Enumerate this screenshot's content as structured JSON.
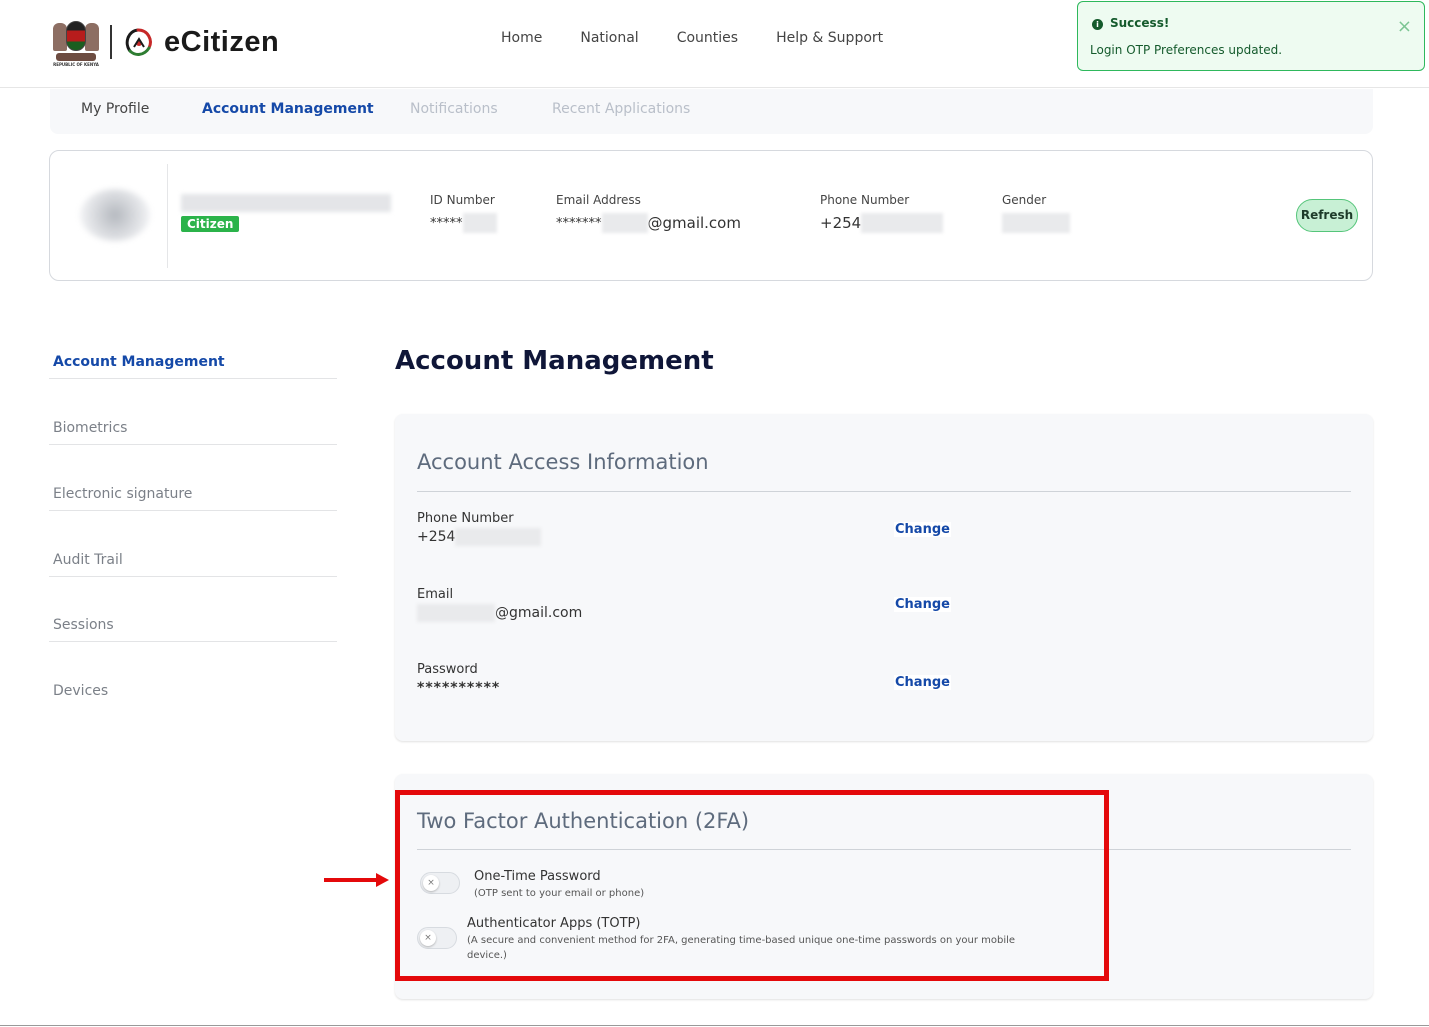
{
  "header": {
    "coat_caption": "REPUBLIC OF KENYA",
    "brand": "eCitizen",
    "nav": [
      "Home",
      "National",
      "Counties",
      "Help & Support"
    ]
  },
  "toast": {
    "title": "Success!",
    "message": "Login OTP Preferences updated.",
    "close": "×"
  },
  "tabs": [
    "My Profile",
    "Account Management",
    "Notifications",
    "Recent Applications"
  ],
  "profile": {
    "badge": "Citizen",
    "id_label": "ID Number",
    "id_value": "*****",
    "email_label": "Email Address",
    "email_prefix": "*******",
    "email_suffix": "@gmail.com",
    "phone_label": "Phone Number",
    "phone_prefix": "+254",
    "gender_label": "Gender",
    "refresh_label": "Refresh"
  },
  "sidebar": {
    "items": [
      "Account Management",
      "Biometrics",
      "Electronic signature",
      "Audit Trail",
      "Sessions",
      "Devices"
    ]
  },
  "main": {
    "title": "Account Management",
    "access": {
      "title": "Account Access Information",
      "phone_label": "Phone Number",
      "phone_prefix": "+254",
      "email_label": "Email",
      "email_suffix": "@gmail.com",
      "password_label": "Password",
      "password_value": "**********",
      "change_label": "Change"
    },
    "tfa": {
      "title": "Two Factor Authentication (2FA)",
      "otp_title": "One-Time Password",
      "otp_desc": "(OTP sent to your email or phone)",
      "totp_title": "Authenticator Apps (TOTP)",
      "totp_desc": "(A secure and convenient method for 2FA, generating time-based unique one-time passwords on your mobile device.)",
      "toggle_off_symbol": "×"
    }
  },
  "colors": {
    "accent": "#1549a8",
    "success": "#2eb85c",
    "annotation": "#e4090b",
    "title": "#0f1638"
  }
}
